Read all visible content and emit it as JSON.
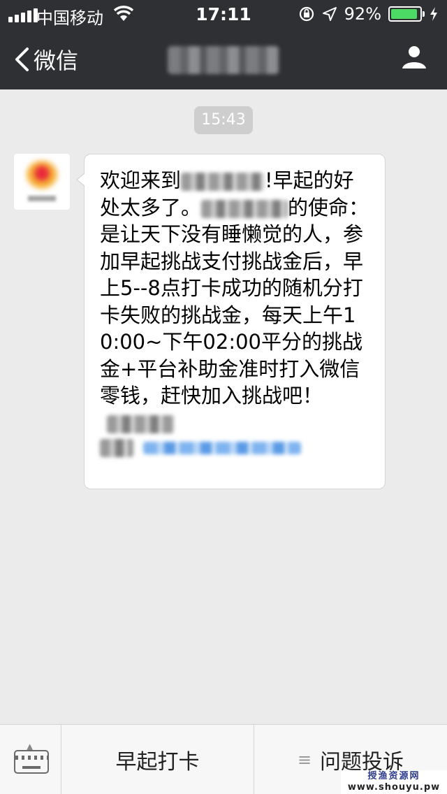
{
  "status_bar": {
    "carrier": "中国移动",
    "time": "17:11",
    "battery_percent": "92%",
    "battery_level": 0.92
  },
  "nav": {
    "back_label": "微信",
    "title_icon": "blurred-title",
    "profile_icon": "person-icon"
  },
  "chat": {
    "timestamp": "15:43",
    "message": {
      "part1": "欢迎来到",
      "part2": "!早起的好处太多了。",
      "part3": "的使命：是让天下没有睡懒觉的人，参加早起挑战支付挑战金后，早上5--8点打卡成功的随机分打卡失败的挑战金，每天上午10:00~下午02:00平分的挑战金+平台补助金准时打入微信零钱，赶快加入挑战吧！"
    }
  },
  "bottom_menu": {
    "keyboard_icon": "keyboard-icon",
    "item1": "早起打卡",
    "item2_icon": "menu-lines-icon",
    "item2": "问题投诉"
  },
  "watermark": {
    "line1": "授渔资源网",
    "line2": "www.shouyu.pw"
  }
}
